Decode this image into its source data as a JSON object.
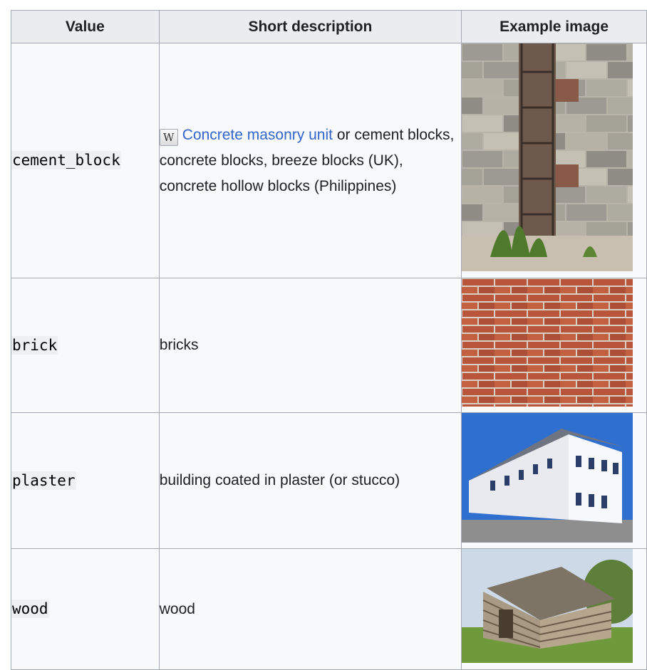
{
  "table": {
    "headers": [
      "Value",
      "Short description",
      "Example image"
    ],
    "rows": [
      {
        "value": "cement_block",
        "link_text": "Concrete masonry unit",
        "description": "or cement blocks, concrete blocks, breeze blocks (UK), concrete hollow blocks (Philippines)",
        "image": "cement block wall with rebar column"
      },
      {
        "value": "brick",
        "description": "bricks",
        "image": "red brick wall"
      },
      {
        "value": "plaster",
        "description": "building coated in plaster (or stucco)",
        "image": "white plastered building"
      },
      {
        "value": "wood",
        "description": "wood",
        "image": "log cabin"
      }
    ],
    "wiki_icon_glyph": "W"
  }
}
